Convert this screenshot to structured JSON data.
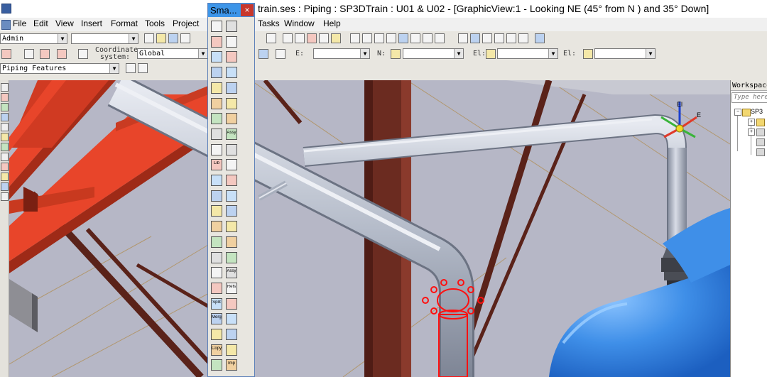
{
  "window": {
    "title": "train.ses : Piping : SP3DTrain : U01 & U02 - [GraphicView:1 - Looking NE (45° from N ) and 35° Down]"
  },
  "menu": {
    "items": [
      "File",
      "Edit",
      "View",
      "Insert",
      "Format",
      "Tools",
      "Project"
    ],
    "items_right": [
      "Tasks",
      "Window",
      "Help"
    ]
  },
  "toolbar": {
    "permission_group": "Admin",
    "active_filter": "",
    "coordinate_system_label": "Coordinate system:",
    "coordinate_system_value": "Global",
    "task_mode": "Piping Features",
    "e_label": "E:",
    "n_label": "N:",
    "el_label": "El:"
  },
  "smart_toolbar": {
    "title": "Sma...",
    "close_label": "×",
    "button_labels": [
      "Assy",
      "Lib",
      "Assy",
      "Refs",
      "Split",
      "Merge",
      "Copy",
      "Imp"
    ]
  },
  "workspace": {
    "title": "Workspace",
    "search_placeholder": "Type here",
    "tree_root": "SP3"
  },
  "viewport": {
    "axis_labels": [
      "El",
      "E"
    ],
    "background_color": "#b6b7c6",
    "steel_color": "#e8452a",
    "pipe_color": "#c4cad6",
    "vessel_color": "#3f8fe8"
  }
}
